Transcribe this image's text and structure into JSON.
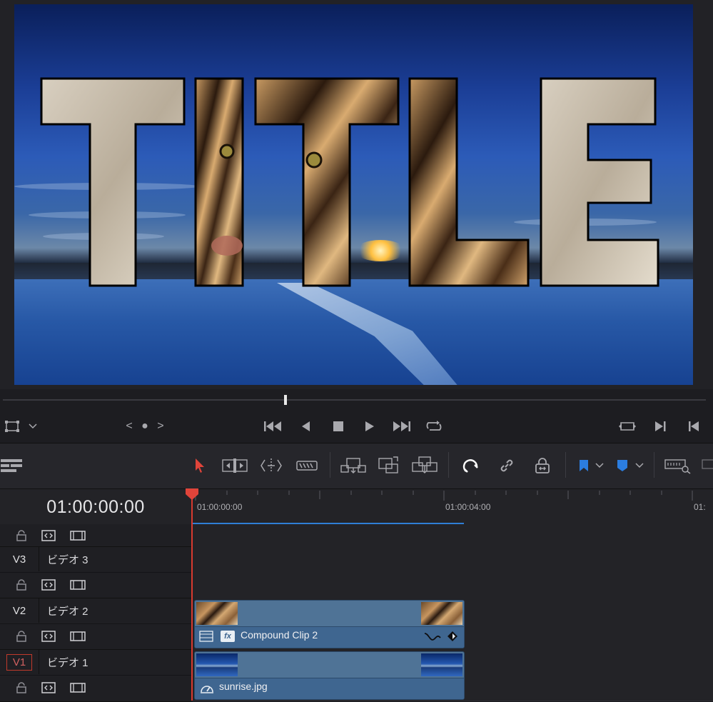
{
  "viewer": {
    "title_text": "TITLE"
  },
  "transport": {
    "viewer_mode": "<  ●  >",
    "icons": [
      "transform-icon",
      "chevron-down-icon",
      "prev-keyframe-icon",
      "nav-dot-icon",
      "next-keyframe-icon",
      "skip-start-icon",
      "reverse-play-icon",
      "stop-icon",
      "play-icon",
      "skip-end-icon",
      "loop-icon",
      "match-frame-icon",
      "next-edit-icon",
      "prev-edit-icon"
    ]
  },
  "toolbar": {
    "icons": [
      "timeline-view-icon",
      "select-tool-icon",
      "trim-tool-icon",
      "dynamic-trim-icon",
      "blade-tool-icon",
      "insert-clip-icon",
      "overwrite-clip-icon",
      "replace-clip-icon",
      "snapping-icon",
      "linked-selection-icon",
      "position-lock-icon",
      "flag-icon",
      "marker-icon",
      "zoom-icon"
    ],
    "accent": "#d83a2f",
    "flag_color": "#2b7de0"
  },
  "timeline": {
    "timecode": "01:00:00:00",
    "ruler": [
      "01:00:00:00",
      "01:00:04:00",
      "01:"
    ]
  },
  "tracks": [
    {
      "id": "V3",
      "name": "ビデオ 3"
    },
    {
      "id": "V2",
      "name": "ビデオ 2"
    },
    {
      "id": "V1",
      "name": "ビデオ 1"
    }
  ],
  "clips": {
    "compound": {
      "name": "Compound Clip 2",
      "fx": "fx"
    },
    "sunrise": {
      "name": "sunrise.jpg"
    }
  }
}
